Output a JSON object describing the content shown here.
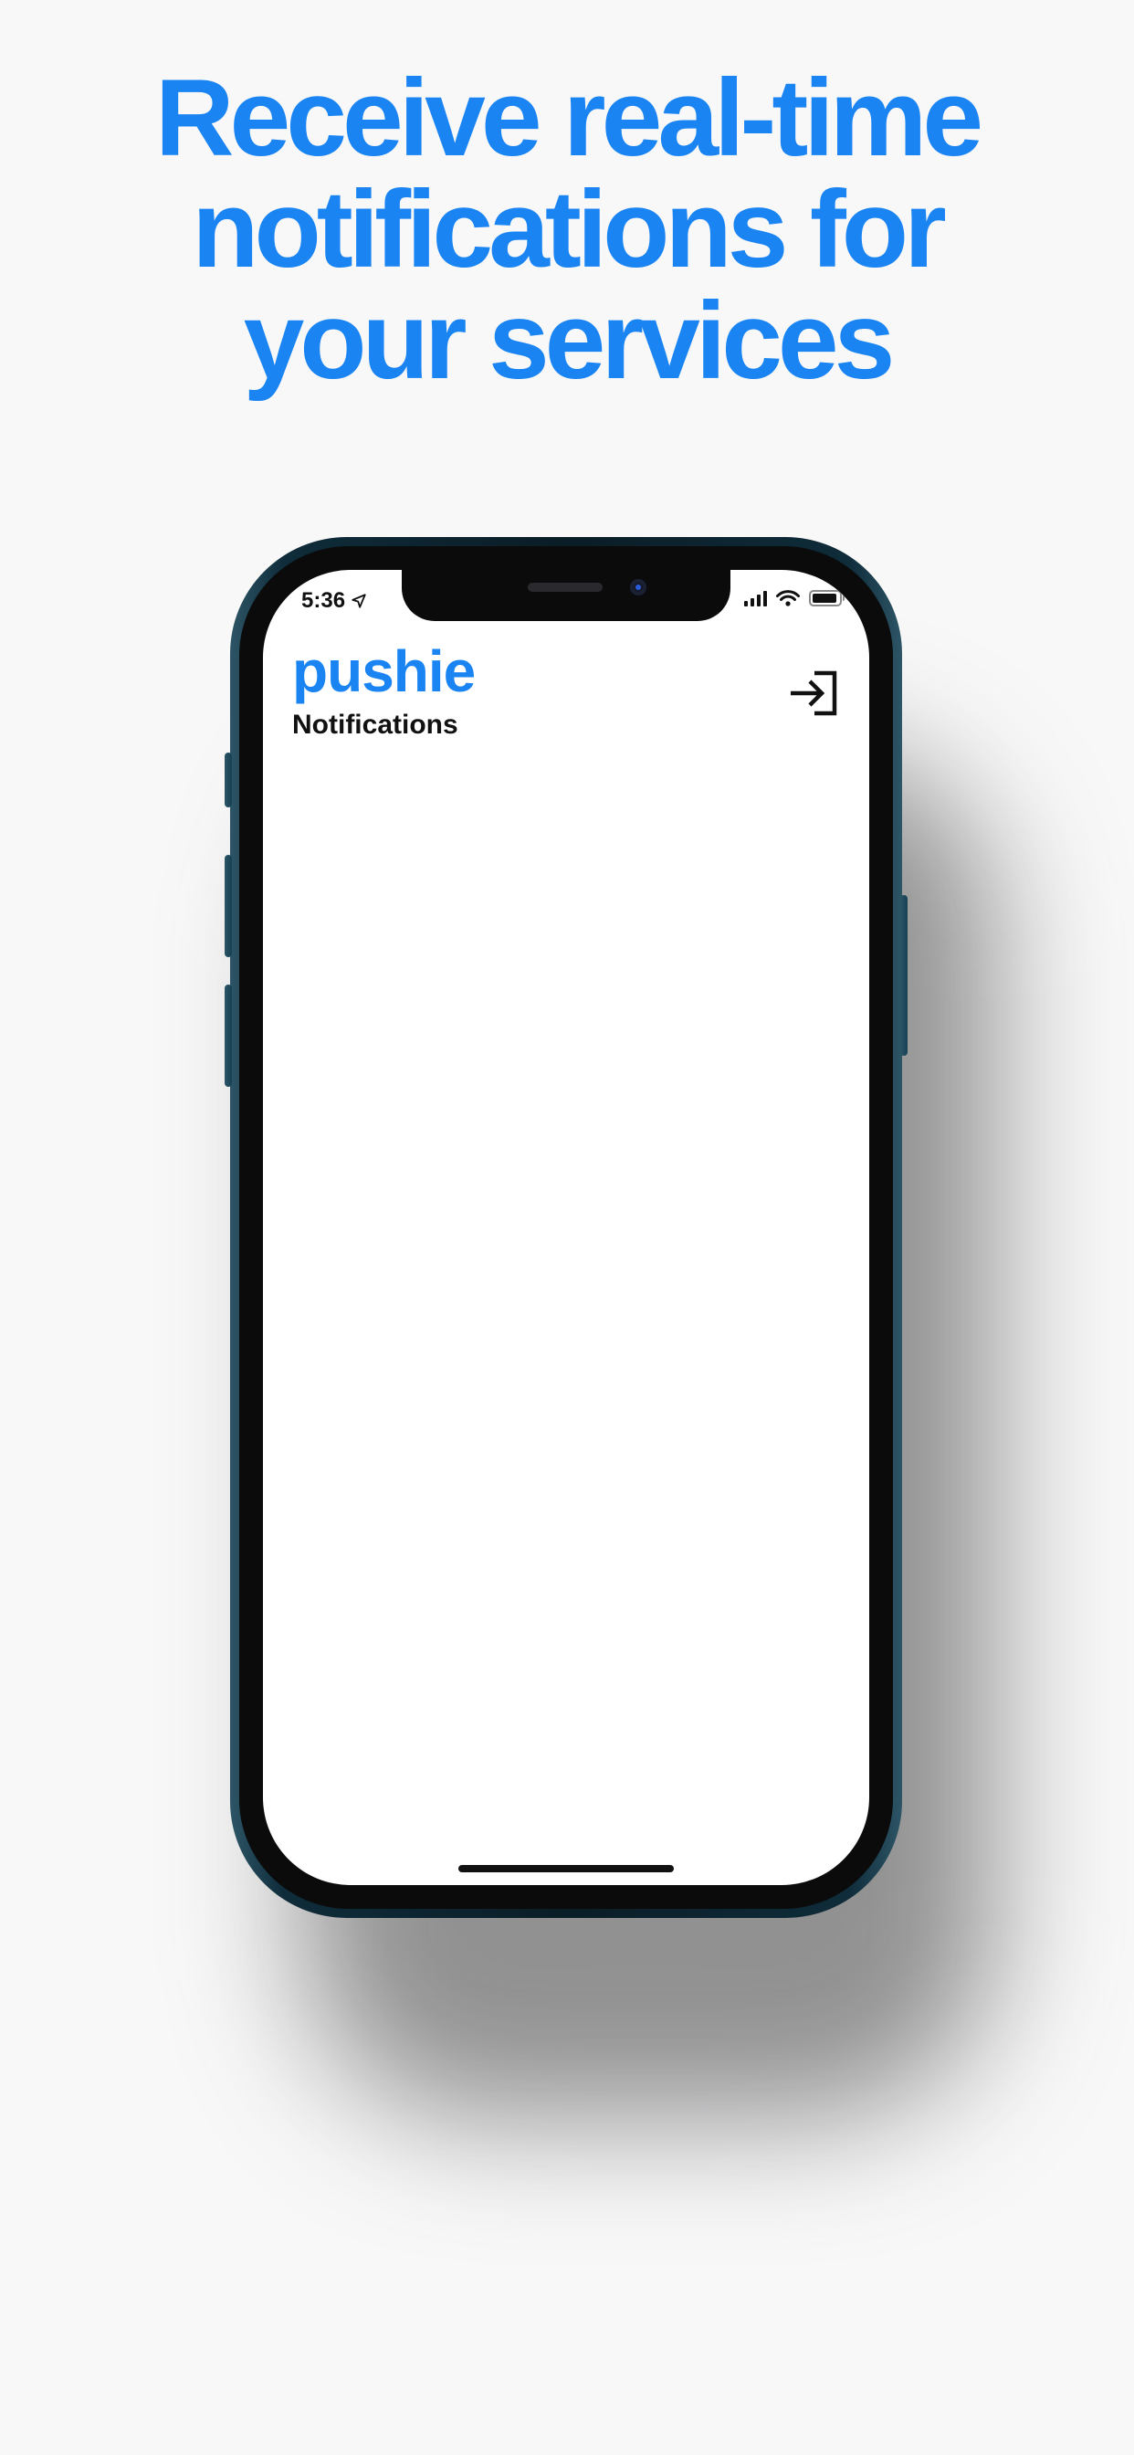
{
  "headline": {
    "line1": "Receive real-time",
    "line2": "notifications for",
    "line3": "your services"
  },
  "status_bar": {
    "time": "5:36",
    "icons": [
      "location-arrow-icon",
      "cellular-signal-icon",
      "wifi-icon",
      "battery-icon"
    ]
  },
  "app": {
    "title": "pushie",
    "subtitle": "Notifications",
    "action_icon": "login-icon"
  },
  "colors": {
    "accent": "#1a84f3",
    "background": "#f8f8f9",
    "text": "#111111",
    "phone_frame": "#0f2c3a"
  }
}
